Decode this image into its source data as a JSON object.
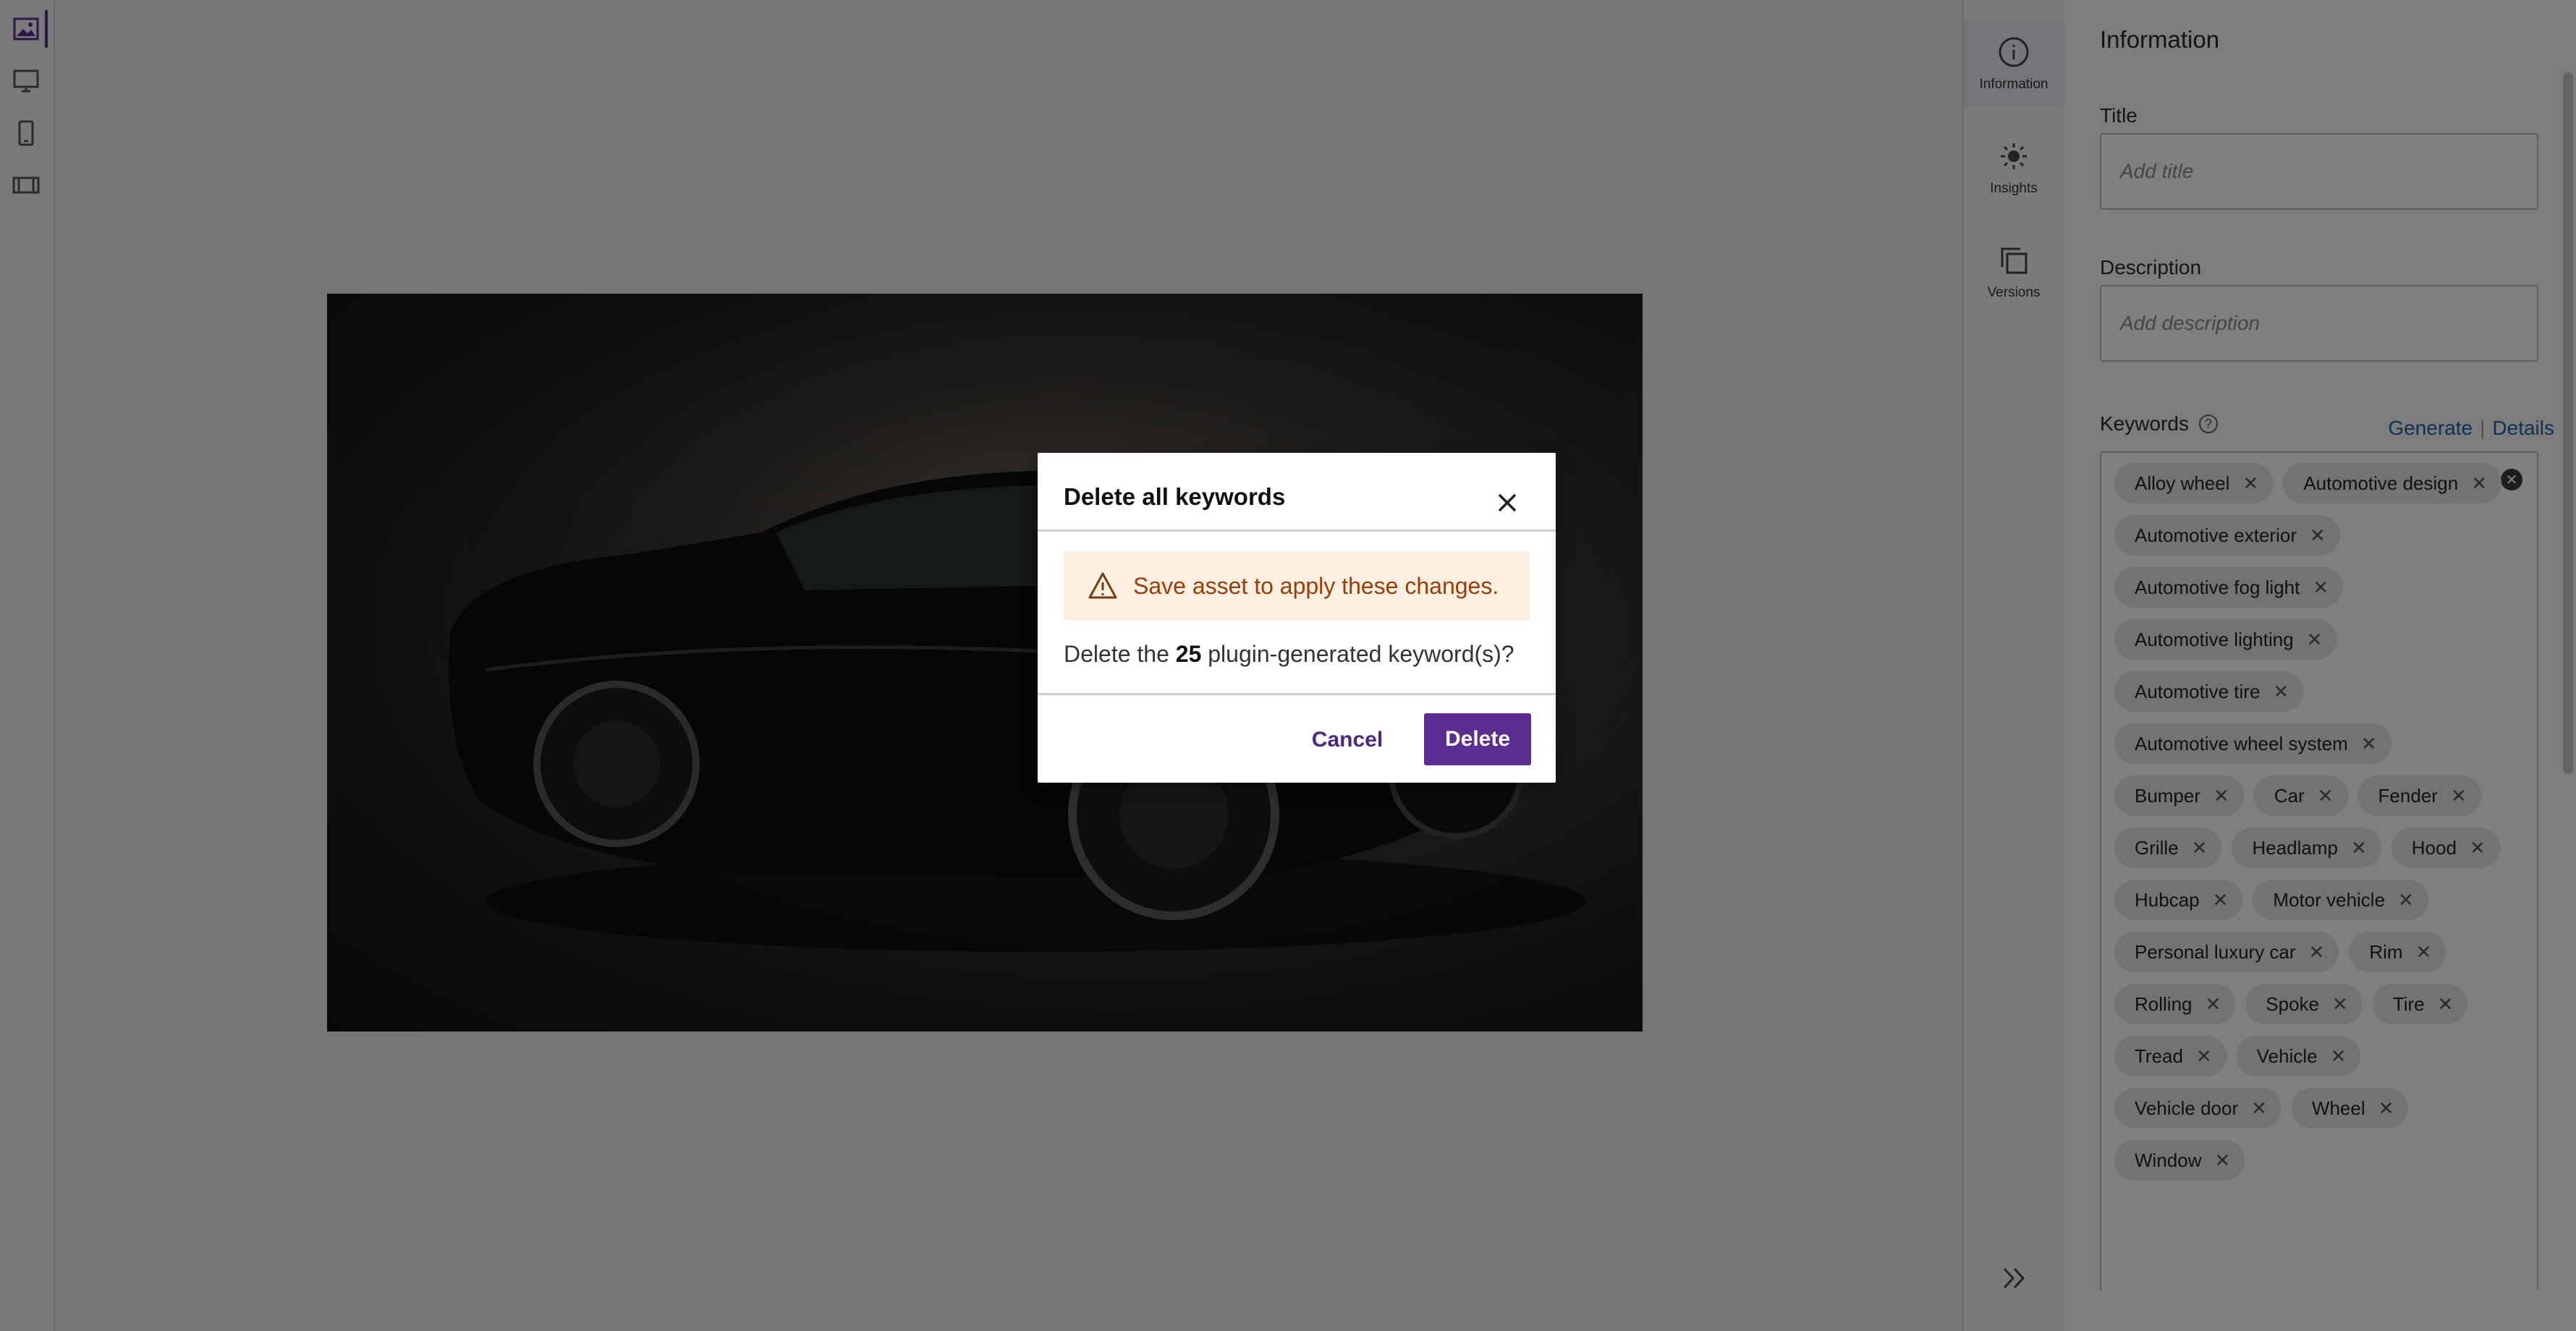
{
  "left_rail": {
    "icons": [
      "image-view-icon",
      "desktop-view-icon",
      "mobile-view-icon",
      "filmstrip-icon"
    ]
  },
  "tabs": [
    {
      "label": "Information",
      "icon": "info-icon"
    },
    {
      "label": "Insights",
      "icon": "sun-icon"
    },
    {
      "label": "Versions",
      "icon": "versions-icon"
    }
  ],
  "panel": {
    "title": "Information",
    "title_label": "Title",
    "title_placeholder": "Add title",
    "description_label": "Description",
    "description_placeholder": "Add description",
    "keywords_label": "Keywords",
    "generate_link": "Generate",
    "details_link": "Details",
    "keywords": [
      "Alloy wheel",
      "Automotive design",
      "Automotive exterior",
      "Automotive fog light",
      "Automotive lighting",
      "Automotive tire",
      "Automotive wheel system",
      "Bumper",
      "Car",
      "Fender",
      "Grille",
      "Headlamp",
      "Hood",
      "Hubcap",
      "Motor vehicle",
      "Personal luxury car",
      "Rim",
      "Rolling",
      "Spoke",
      "Tire",
      "Tread",
      "Vehicle",
      "Vehicle door",
      "Wheel",
      "Window"
    ]
  },
  "dialog": {
    "title": "Delete all keywords",
    "warning": "Save asset to apply these changes.",
    "message_prefix": "Delete the ",
    "count": "25",
    "message_suffix": " plugin-generated keyword(s)?",
    "cancel_label": "Cancel",
    "delete_label": "Delete"
  },
  "colors": {
    "accent": "#5b2d90",
    "warning_bg": "#fdf0e2",
    "warning_text": "#9a3c06",
    "link": "#2060b0"
  }
}
